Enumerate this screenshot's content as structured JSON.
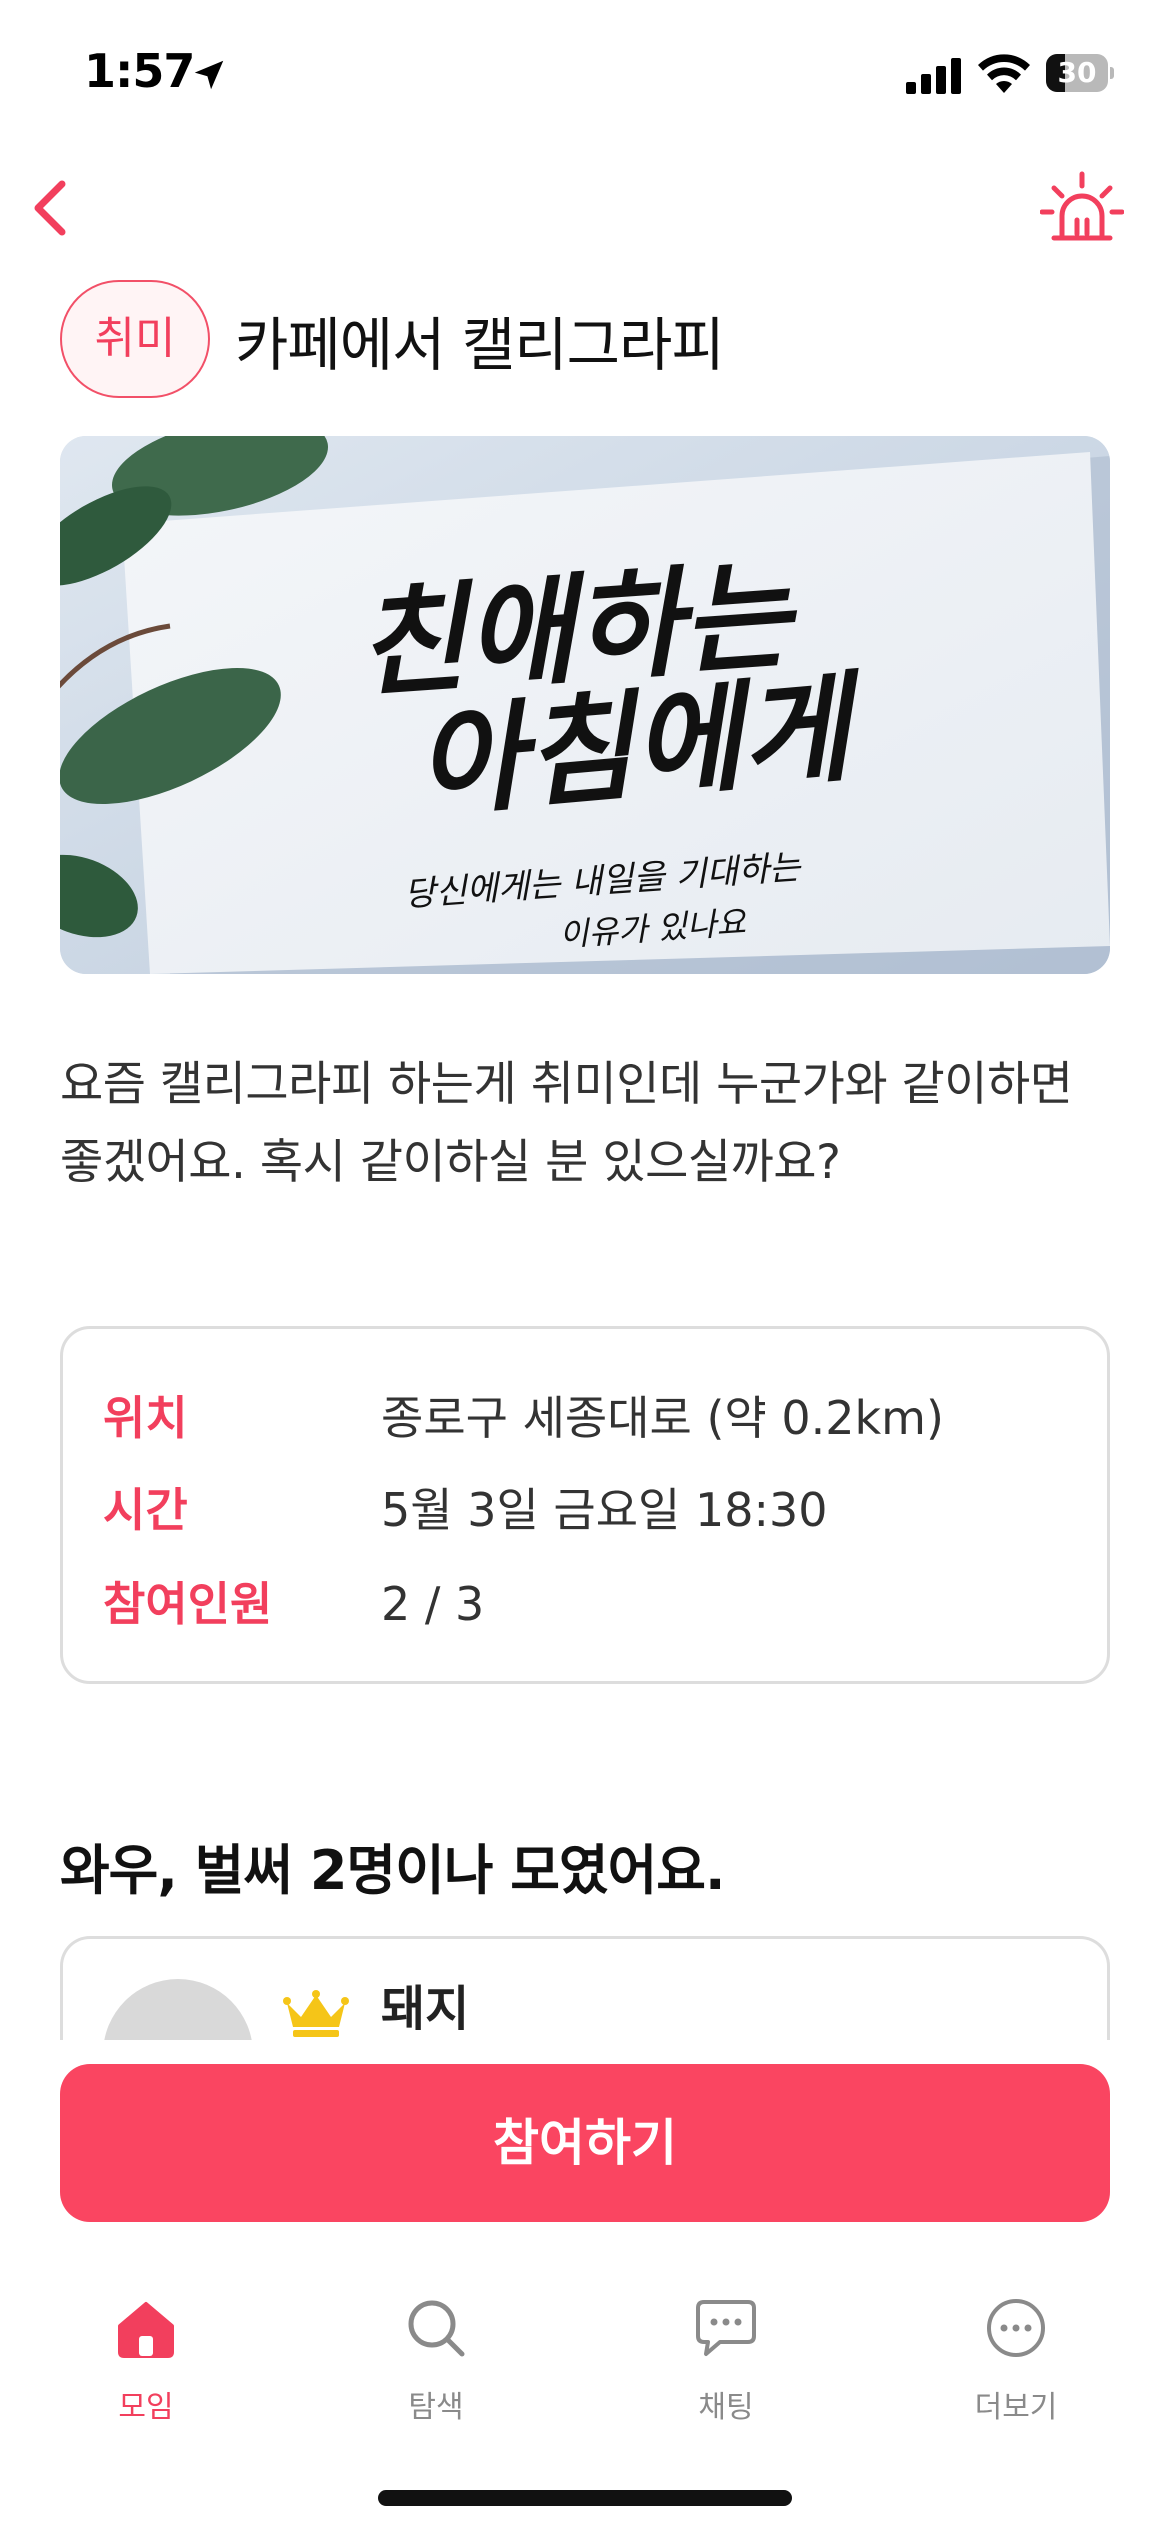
{
  "status_bar": {
    "time": "1:57",
    "battery_level": "30",
    "battery_fraction": 0.3
  },
  "header": {
    "back_icon": "chevron-left-icon",
    "alarm_icon": "siren-icon"
  },
  "post": {
    "category": "취미",
    "title": "카페에서 캘리그라피",
    "image_text_line1": "친애하는",
    "image_text_line2": "아침에게",
    "image_text_line3": "당신에게는 내일을 기대하는",
    "image_text_line4": "이유가 있나요",
    "description": "요즘 캘리그라피 하는게 취미인데 누군가와 같이하면 좋겠어요. 혹시 같이하실 분 있으실까요?"
  },
  "info": {
    "location_label": "위치",
    "location_value": "종로구 세종대로 (약 0.2km)",
    "time_label": "시간",
    "time_value": "5월 3일 금요일 18:30",
    "participants_label": "참여인원",
    "participants_value": "2 / 3"
  },
  "members": {
    "heading": "와우, 벌써 2명이나 모였어요.",
    "host_name": "돼지",
    "host_icon": "crown-icon"
  },
  "join_button": "참여하기",
  "tabs": [
    {
      "label": "모임",
      "icon": "home-icon"
    },
    {
      "label": "탐색",
      "icon": "search-icon"
    },
    {
      "label": "채팅",
      "icon": "chat-icon"
    },
    {
      "label": "더보기",
      "icon": "more-icon"
    }
  ],
  "colors": {
    "accent": "#f23f5d",
    "button": "#fa4561",
    "inactive": "#8a8a8a",
    "crown": "#f5c518"
  }
}
